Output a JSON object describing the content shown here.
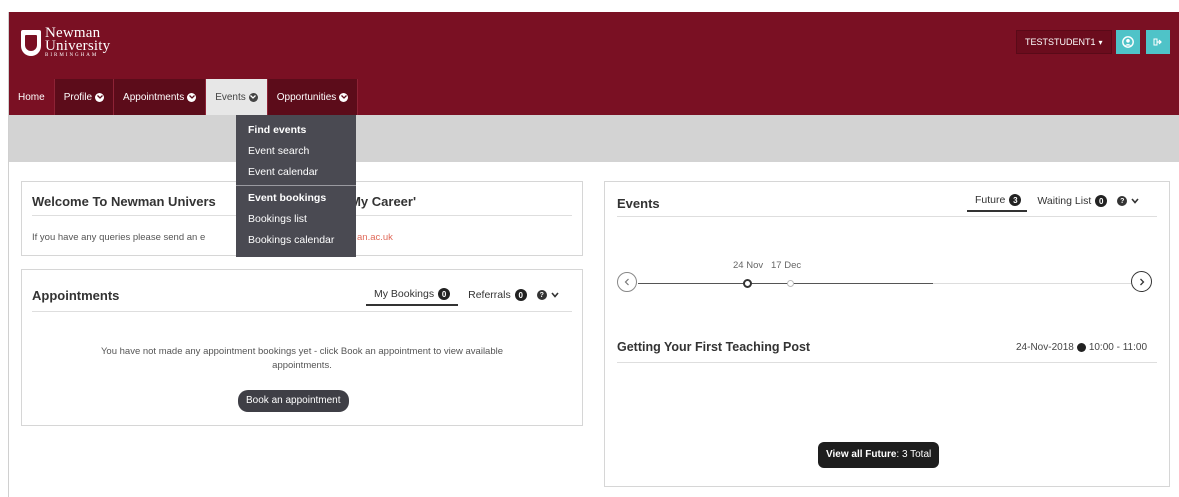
{
  "brand": {
    "logo_name": "Newman",
    "logo_name2": "University",
    "logo_sub": "BIRMINGHAM"
  },
  "header": {
    "user_label": "TESTSTUDENT1",
    "profile_icon": "user-circle-icon",
    "logout_icon": "sign-out-icon",
    "accent_color": "#4fc3c8",
    "brand_color": "#7a1023"
  },
  "nav": {
    "items": [
      {
        "label": "Home"
      },
      {
        "label": "Profile"
      },
      {
        "label": "Appointments"
      },
      {
        "label": "Events"
      },
      {
        "label": "Opportunities"
      }
    ]
  },
  "events_menu": {
    "find_header": "Find events",
    "event_search": "Event search",
    "event_calendar": "Event calendar",
    "bookings_header": "Event bookings",
    "bookings_list": "Bookings list",
    "bookings_calendar": "Bookings calendar"
  },
  "welcome": {
    "title_part1": "Welcome To Newman Univers",
    "title_part2": "'My Career'",
    "text": "If you have any queries please send an e",
    "link_fragment": "an.ac.uk"
  },
  "appointments": {
    "title": "Appointments",
    "tab_bookings": "My Bookings",
    "tab_bookings_count": "0",
    "tab_referrals": "Referrals",
    "tab_referrals_count": "0",
    "message_line1": "You have not made any appointment bookings yet - click Book an appointment to view available",
    "message_line2": "appointments.",
    "book_button": "Book an appointment"
  },
  "events": {
    "title": "Events",
    "tab_future": "Future",
    "tab_future_count": "3",
    "tab_waiting": "Waiting List",
    "tab_waiting_count": "0",
    "timeline_date1": "24 Nov",
    "timeline_date2": "17 Dec",
    "event_title": "Getting Your First Teaching Post",
    "event_date": "24-Nov-2018",
    "event_time": "10:00 - 11:00",
    "view_all_bold": "View all Future",
    "view_all_rest": ": 3 Total"
  }
}
